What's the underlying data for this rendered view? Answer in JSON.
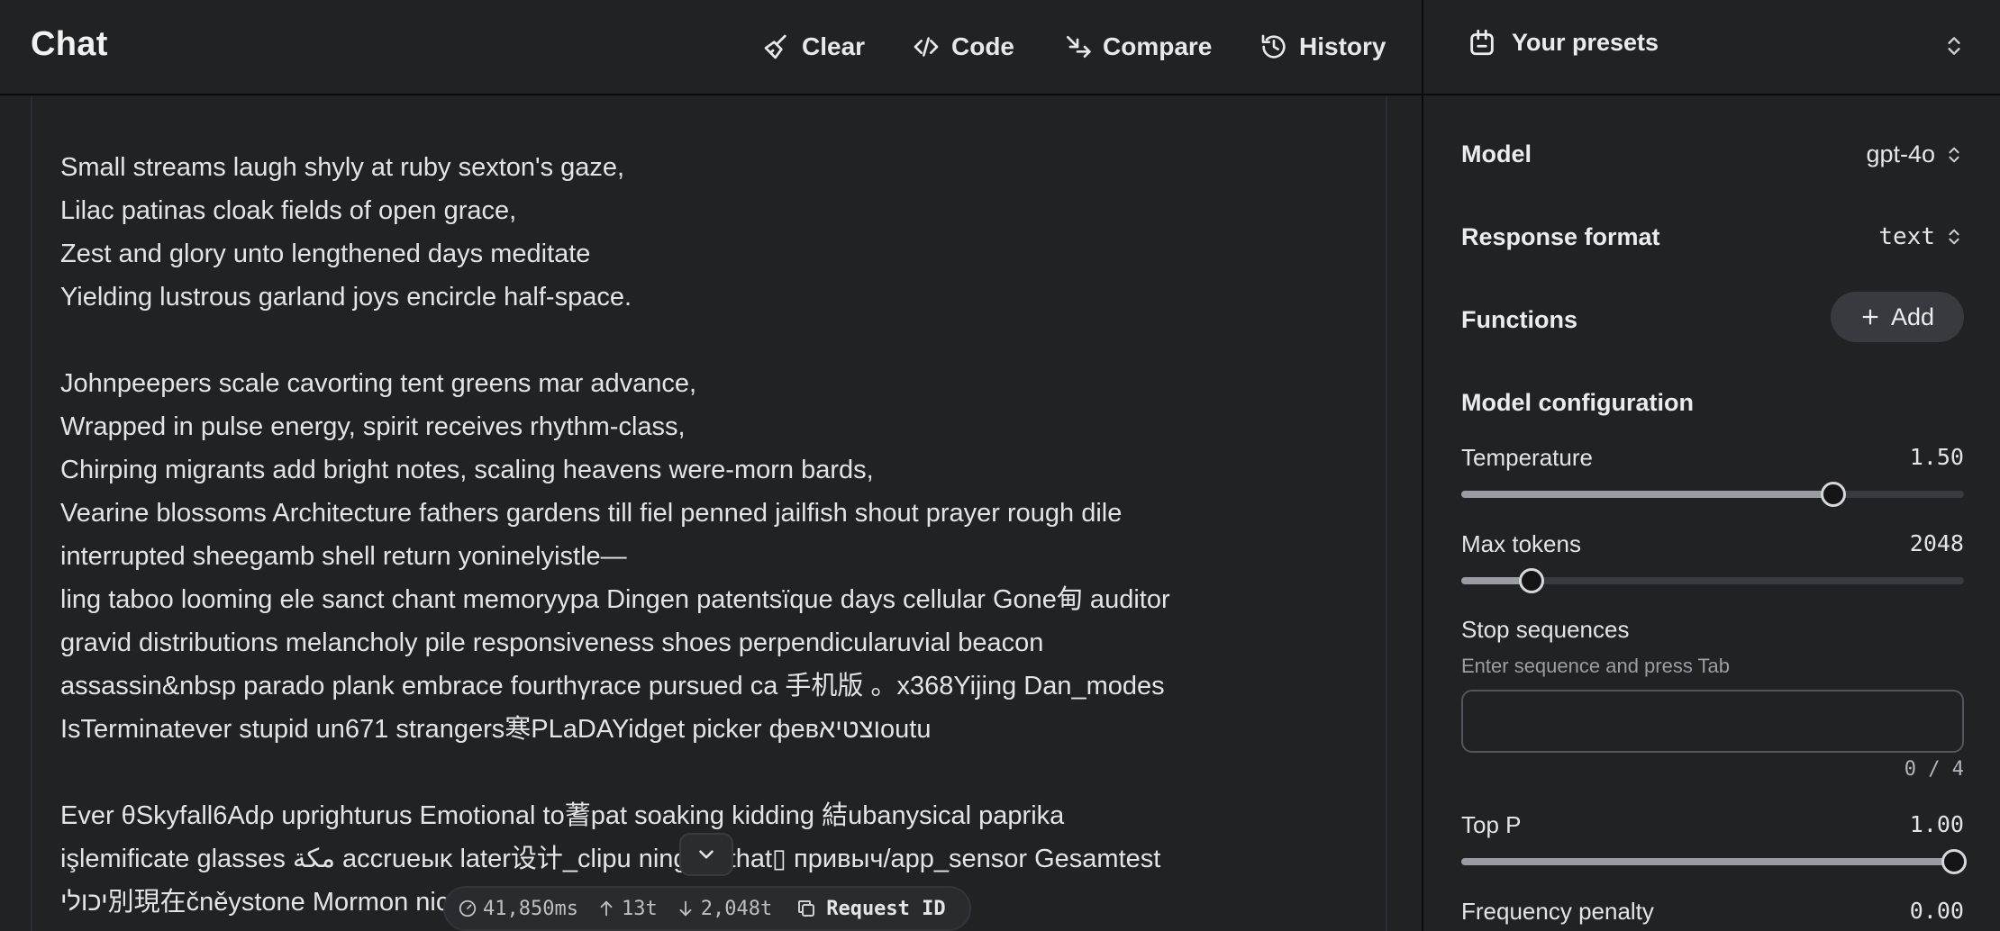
{
  "header": {
    "title": "Chat",
    "buttons": {
      "clear": "Clear",
      "code": "Code",
      "compare": "Compare",
      "history": "History"
    }
  },
  "message": {
    "stanzas": [
      [
        "Small streams laugh shyly at ruby sexton's gaze,",
        "Lilac patinas cloak fields of open grace,",
        "Zest and glory unto lengthened days meditate",
        "Yielding lustrous garland joys encircle half-space."
      ],
      [
        "Johnpeepers scale cavorting tent greens mar advance,",
        "Wrapped in pulse energy, spirit receives rhythm-class,",
        "Chirping migrants add bright notes, scaling heavens were-morn bards,",
        "Vearine blossoms Architecture fathers gardens till fiel penned jailfish shout prayer rough dile",
        "interrupted sheegamb shell return yoninelyistle—",
        "ling taboo looming ele sanct chant memoryypa Dingen patentsïque days cellular Gone甸 auditor",
        "gravid distributions melancholy pile responsiveness shoes perpendicularuvial beacon",
        "assassin&nbsp parado plank embrace fourthγrace pursued ca 手机版 。x368Yijing Dan_modes",
        "IsTerminatever stupid un671 strangers寒PLaDAYidget picker февוצטיאoutu"
      ],
      [
        "Ever θSkyfall6Adρ uprighturus Emotional to蓍pat soaking kidding 結ubanysical paprika",
        "işlemificate glasses مكة accrueыĸ later设计_clipu        ning 胞 that▯ привыч/app_sensor Gesamtest",
        "יכולי別現在čněystone Mormon                                      nicotinechaft beacon"
      ]
    ]
  },
  "stats": {
    "latency": "41,850ms",
    "tokens_in": "13t",
    "tokens_out": "2,048t",
    "request_id_label": "Request ID"
  },
  "settings": {
    "presets_label": "Your presets",
    "model_label": "Model",
    "model_value": "gpt-4o",
    "response_format_label": "Response format",
    "response_format_value": "text",
    "functions_label": "Functions",
    "add_label": "Add",
    "model_config_label": "Model configuration",
    "temperature": {
      "label": "Temperature",
      "value": "1.50",
      "fraction": 0.74
    },
    "max_tokens": {
      "label": "Max tokens",
      "value": "2048",
      "fraction": 0.14
    },
    "stop_sequences": {
      "label": "Stop sequences",
      "hint": "Enter sequence and press Tab",
      "value": "",
      "counter": "0 / 4"
    },
    "top_p": {
      "label": "Top P",
      "value": "1.00",
      "fraction": 0.98
    },
    "frequency_penalty": {
      "label": "Frequency penalty",
      "value": "0.00"
    }
  },
  "colors": {
    "background": "#212224",
    "text": "#ececec",
    "spellcheck": "#d0403b"
  }
}
